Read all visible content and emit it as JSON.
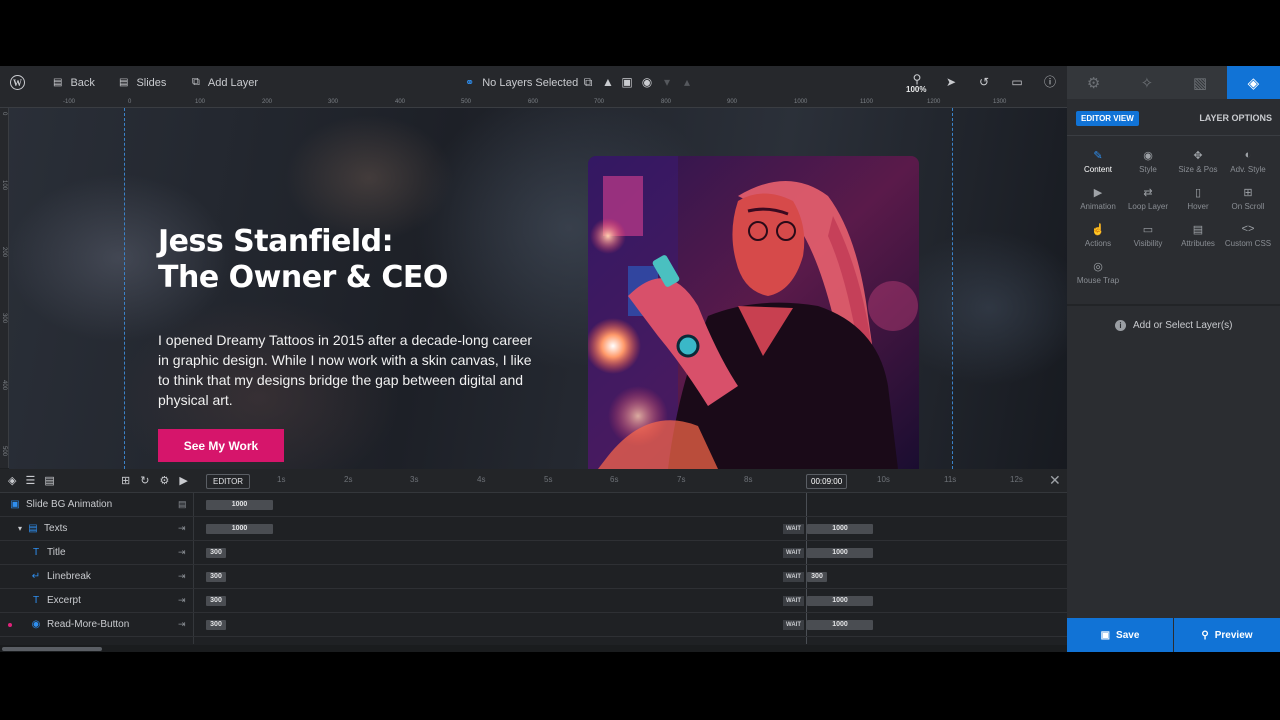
{
  "toolbar": {
    "back": "Back",
    "slides": "Slides",
    "add_layer": "Add Layer",
    "layers_status": "No Layers Selected",
    "zoom": "100%"
  },
  "ruler": {
    "h_ticks": [
      "-100",
      "0",
      "100",
      "200",
      "300",
      "400",
      "500",
      "600",
      "700",
      "800",
      "900",
      "1000",
      "1100",
      "1200",
      "1300"
    ],
    "v_ticks": [
      "0",
      "100",
      "200",
      "300",
      "400",
      "500"
    ]
  },
  "slide": {
    "title_line1": "Jess Stanfield:",
    "title_line2": "The Owner & CEO",
    "excerpt": "I opened Dreamy Tattoos in 2015 after a decade-long career in graphic design. While I now work with a skin canvas, I like to think that my designs bridge the gap between digital and physical art.",
    "button": "See My Work",
    "button_color": "#d6156b"
  },
  "panel": {
    "editor_view": "EDITOR VIEW",
    "layer_options": "LAYER OPTIONS",
    "options": [
      {
        "label": "Content",
        "icon": "pencil-icon"
      },
      {
        "label": "Style",
        "icon": "palette-icon"
      },
      {
        "label": "Size & Pos",
        "icon": "move-icon"
      },
      {
        "label": "Adv. Style",
        "icon": "contrast-icon"
      },
      {
        "label": "Animation",
        "icon": "play-icon"
      },
      {
        "label": "Loop Layer",
        "icon": "loop-icon"
      },
      {
        "label": "Hover",
        "icon": "mouse-icon"
      },
      {
        "label": "On Scroll",
        "icon": "scroll-icon"
      },
      {
        "label": "Actions",
        "icon": "actions-icon"
      },
      {
        "label": "Visibility",
        "icon": "visibility-icon"
      },
      {
        "label": "Attributes",
        "icon": "document-icon"
      },
      {
        "label": "Custom CSS",
        "icon": "code-icon"
      },
      {
        "label": "Mouse Trap",
        "icon": "target-icon"
      }
    ],
    "empty_message": "Add or Select Layer(s)",
    "save": "Save",
    "preview": "Preview",
    "accent": "#1173d6"
  },
  "timeline": {
    "editor_tag": "EDITOR",
    "ticks": [
      "1s",
      "2s",
      "3s",
      "4s",
      "5s",
      "6s",
      "7s",
      "8s",
      "10s",
      "11s",
      "12s"
    ],
    "current_time": "00:09:00",
    "rows": [
      {
        "name": "Slide BG Animation",
        "start_bar": "1000",
        "wait": "",
        "end_bar": ""
      },
      {
        "name": "Texts",
        "start_bar": "1000",
        "wait": "WAIT",
        "end_bar": "1000"
      },
      {
        "name": "Title",
        "start_bar": "300",
        "wait": "WAIT",
        "end_bar": "1000"
      },
      {
        "name": "Linebreak",
        "start_bar": "300",
        "wait": "WAIT",
        "end_bar": "300"
      },
      {
        "name": "Excerpt",
        "start_bar": "300",
        "wait": "WAIT",
        "end_bar": "1000"
      },
      {
        "name": "Read-More-Button",
        "start_bar": "300",
        "wait": "WAIT",
        "end_bar": "1000"
      }
    ]
  }
}
